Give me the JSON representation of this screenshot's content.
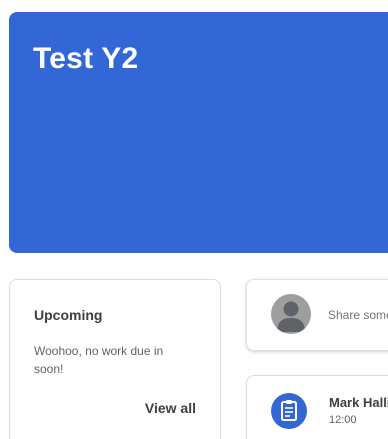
{
  "banner": {
    "title": "Test Y2",
    "color": "#3367d6"
  },
  "upcoming": {
    "title": "Upcoming",
    "message": "Woohoo, no work due in soon!",
    "view_all_label": "View all"
  },
  "share": {
    "avatar_icon": "person-icon",
    "placeholder": "Share something with your class"
  },
  "post": {
    "icon": "assignment-icon",
    "author": "Mark Halliday",
    "time": "12:00"
  }
}
